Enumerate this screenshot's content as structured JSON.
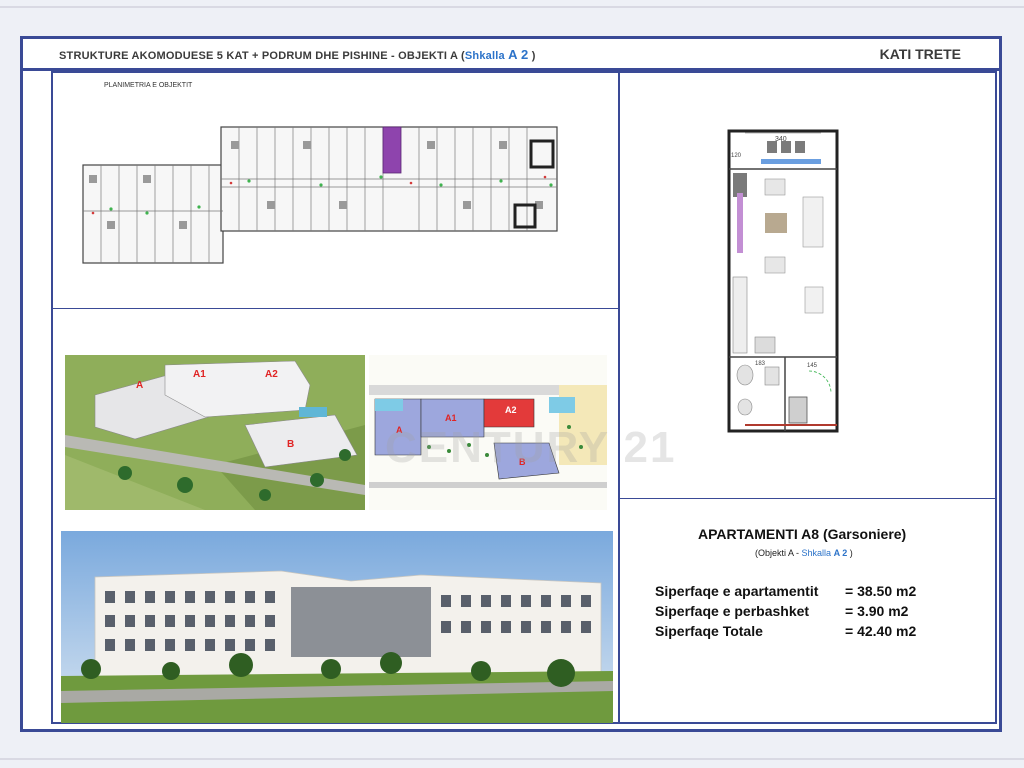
{
  "header": {
    "title_main": "STRUKTURE AKOMODUESE 5 KAT + PODRUM DHE PISHINE   - OBJEKTI A (",
    "title_accent": "Shkalla ",
    "title_accent_bold": "A 2",
    "title_close": " )",
    "floor": "KATI TRETE"
  },
  "plan": {
    "label": "PLANIMETRIA E OBJEKTIT"
  },
  "aerial": {
    "block_labels": [
      "A",
      "A1",
      "A2",
      "B"
    ]
  },
  "site": {
    "block_labels": [
      "A",
      "A1",
      "A2",
      "B"
    ]
  },
  "watermark": "CENTURY 21",
  "unit_plan": {
    "dims": [
      "340",
      "120",
      "145",
      "183"
    ]
  },
  "apartment": {
    "title": "APARTAMENTI A8 (Garsoniere)",
    "sub_open": "(Objekti A - ",
    "sub_accent": "Shkalla ",
    "sub_accent_bold": "A 2",
    "sub_close": " )",
    "areas": [
      {
        "label": "Siperfaqe e apartamentit",
        "value": "= 38.50 m2"
      },
      {
        "label": "Siperfaqe e perbashket",
        "value": "=  3.90 m2"
      },
      {
        "label": "Siperfaqe Totale",
        "value": "= 42.40 m2"
      }
    ]
  },
  "colors": {
    "frame": "#3a4a96",
    "accent": "#2c73c9",
    "stair_highlight": "#8e44ad",
    "a2_highlight": "#e23b3b"
  }
}
